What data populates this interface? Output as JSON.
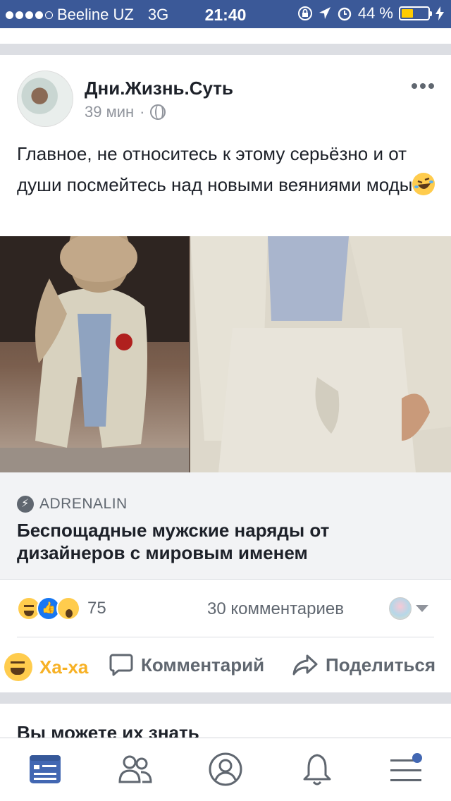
{
  "status_bar": {
    "carrier": "Beeline UZ",
    "network": "3G",
    "time": "21:40",
    "battery": "44 %",
    "battery_level": 0.44,
    "signal_bars": 4
  },
  "post": {
    "page_name": "Дни.Жизнь.Суть",
    "time_ago": "39 мин",
    "meta_separator": "·",
    "text": "Главное, не относитесь к этому серьёзно и от души посмейтесь над новыми веяниями моды"
  },
  "link_preview": {
    "source": "ADRENALIN",
    "title": "Беспощадные мужские наряды от дизайнеров с мировым именем"
  },
  "reactions": {
    "count": "75",
    "comments": "30 комментариев"
  },
  "actions": {
    "haha": "Ха-ха",
    "comment": "Комментарий",
    "share": "Поделиться"
  },
  "section": {
    "title": "Вы можете их знать"
  },
  "colors": {
    "header_blue": "#3b5998",
    "haha_yellow": "#f7b125",
    "nav_blue": "#4267b2"
  },
  "icons": [
    "globe-icon",
    "more-icon",
    "haha-icon",
    "like-icon",
    "wow-icon",
    "comment-icon",
    "share-icon",
    "news-feed-icon",
    "friends-icon",
    "profile-icon",
    "notifications-icon",
    "menu-icon"
  ]
}
